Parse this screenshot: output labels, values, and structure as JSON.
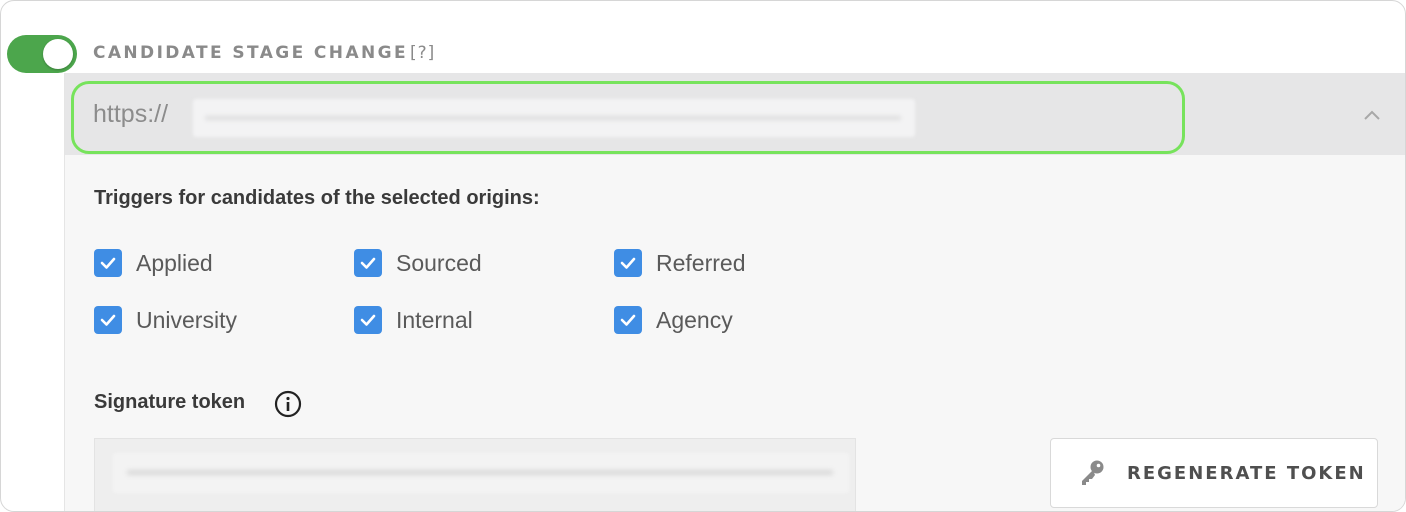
{
  "webhook": {
    "title": "CANDIDATE STAGE CHANGE",
    "help_link": "[?]",
    "enabled": true,
    "url_prefix": "https://"
  },
  "triggers": {
    "label": "Triggers for candidates of the selected origins:",
    "options": [
      {
        "label": "Applied",
        "checked": true
      },
      {
        "label": "Sourced",
        "checked": true
      },
      {
        "label": "Referred",
        "checked": true
      },
      {
        "label": "University",
        "checked": true
      },
      {
        "label": "Internal",
        "checked": true
      },
      {
        "label": "Agency",
        "checked": true
      }
    ]
  },
  "signature": {
    "label": "Signature token",
    "info_icon": "info-icon",
    "regenerate_label": "REGENERATE TOKEN",
    "regenerate_icon": "key-icon"
  },
  "colors": {
    "toggle_on": "#4ca64c",
    "checkbox": "#3f8de4",
    "highlight": "#77e35c"
  }
}
